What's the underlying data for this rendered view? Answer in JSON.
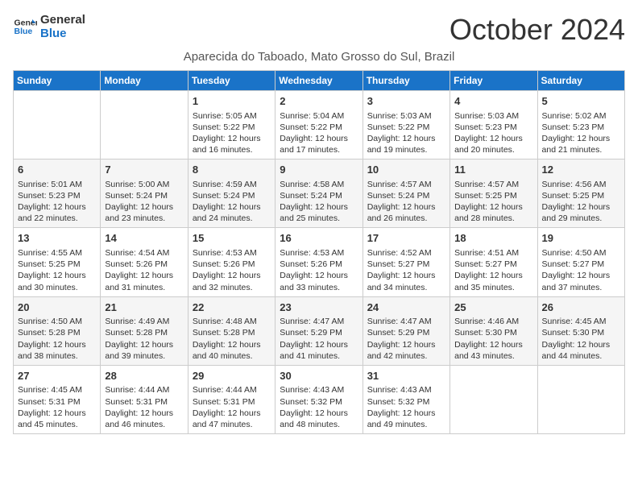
{
  "logo": {
    "line1": "General",
    "line2": "Blue"
  },
  "title": "October 2024",
  "location": "Aparecida do Taboado, Mato Grosso do Sul, Brazil",
  "days_of_week": [
    "Sunday",
    "Monday",
    "Tuesday",
    "Wednesday",
    "Thursday",
    "Friday",
    "Saturday"
  ],
  "weeks": [
    [
      {
        "day": "",
        "info": ""
      },
      {
        "day": "",
        "info": ""
      },
      {
        "day": "1",
        "info": "Sunrise: 5:05 AM\nSunset: 5:22 PM\nDaylight: 12 hours and 16 minutes."
      },
      {
        "day": "2",
        "info": "Sunrise: 5:04 AM\nSunset: 5:22 PM\nDaylight: 12 hours and 17 minutes."
      },
      {
        "day": "3",
        "info": "Sunrise: 5:03 AM\nSunset: 5:22 PM\nDaylight: 12 hours and 19 minutes."
      },
      {
        "day": "4",
        "info": "Sunrise: 5:03 AM\nSunset: 5:23 PM\nDaylight: 12 hours and 20 minutes."
      },
      {
        "day": "5",
        "info": "Sunrise: 5:02 AM\nSunset: 5:23 PM\nDaylight: 12 hours and 21 minutes."
      }
    ],
    [
      {
        "day": "6",
        "info": "Sunrise: 5:01 AM\nSunset: 5:23 PM\nDaylight: 12 hours and 22 minutes."
      },
      {
        "day": "7",
        "info": "Sunrise: 5:00 AM\nSunset: 5:24 PM\nDaylight: 12 hours and 23 minutes."
      },
      {
        "day": "8",
        "info": "Sunrise: 4:59 AM\nSunset: 5:24 PM\nDaylight: 12 hours and 24 minutes."
      },
      {
        "day": "9",
        "info": "Sunrise: 4:58 AM\nSunset: 5:24 PM\nDaylight: 12 hours and 25 minutes."
      },
      {
        "day": "10",
        "info": "Sunrise: 4:57 AM\nSunset: 5:24 PM\nDaylight: 12 hours and 26 minutes."
      },
      {
        "day": "11",
        "info": "Sunrise: 4:57 AM\nSunset: 5:25 PM\nDaylight: 12 hours and 28 minutes."
      },
      {
        "day": "12",
        "info": "Sunrise: 4:56 AM\nSunset: 5:25 PM\nDaylight: 12 hours and 29 minutes."
      }
    ],
    [
      {
        "day": "13",
        "info": "Sunrise: 4:55 AM\nSunset: 5:25 PM\nDaylight: 12 hours and 30 minutes."
      },
      {
        "day": "14",
        "info": "Sunrise: 4:54 AM\nSunset: 5:26 PM\nDaylight: 12 hours and 31 minutes."
      },
      {
        "day": "15",
        "info": "Sunrise: 4:53 AM\nSunset: 5:26 PM\nDaylight: 12 hours and 32 minutes."
      },
      {
        "day": "16",
        "info": "Sunrise: 4:53 AM\nSunset: 5:26 PM\nDaylight: 12 hours and 33 minutes."
      },
      {
        "day": "17",
        "info": "Sunrise: 4:52 AM\nSunset: 5:27 PM\nDaylight: 12 hours and 34 minutes."
      },
      {
        "day": "18",
        "info": "Sunrise: 4:51 AM\nSunset: 5:27 PM\nDaylight: 12 hours and 35 minutes."
      },
      {
        "day": "19",
        "info": "Sunrise: 4:50 AM\nSunset: 5:27 PM\nDaylight: 12 hours and 37 minutes."
      }
    ],
    [
      {
        "day": "20",
        "info": "Sunrise: 4:50 AM\nSunset: 5:28 PM\nDaylight: 12 hours and 38 minutes."
      },
      {
        "day": "21",
        "info": "Sunrise: 4:49 AM\nSunset: 5:28 PM\nDaylight: 12 hours and 39 minutes."
      },
      {
        "day": "22",
        "info": "Sunrise: 4:48 AM\nSunset: 5:28 PM\nDaylight: 12 hours and 40 minutes."
      },
      {
        "day": "23",
        "info": "Sunrise: 4:47 AM\nSunset: 5:29 PM\nDaylight: 12 hours and 41 minutes."
      },
      {
        "day": "24",
        "info": "Sunrise: 4:47 AM\nSunset: 5:29 PM\nDaylight: 12 hours and 42 minutes."
      },
      {
        "day": "25",
        "info": "Sunrise: 4:46 AM\nSunset: 5:30 PM\nDaylight: 12 hours and 43 minutes."
      },
      {
        "day": "26",
        "info": "Sunrise: 4:45 AM\nSunset: 5:30 PM\nDaylight: 12 hours and 44 minutes."
      }
    ],
    [
      {
        "day": "27",
        "info": "Sunrise: 4:45 AM\nSunset: 5:31 PM\nDaylight: 12 hours and 45 minutes."
      },
      {
        "day": "28",
        "info": "Sunrise: 4:44 AM\nSunset: 5:31 PM\nDaylight: 12 hours and 46 minutes."
      },
      {
        "day": "29",
        "info": "Sunrise: 4:44 AM\nSunset: 5:31 PM\nDaylight: 12 hours and 47 minutes."
      },
      {
        "day": "30",
        "info": "Sunrise: 4:43 AM\nSunset: 5:32 PM\nDaylight: 12 hours and 48 minutes."
      },
      {
        "day": "31",
        "info": "Sunrise: 4:43 AM\nSunset: 5:32 PM\nDaylight: 12 hours and 49 minutes."
      },
      {
        "day": "",
        "info": ""
      },
      {
        "day": "",
        "info": ""
      }
    ]
  ]
}
